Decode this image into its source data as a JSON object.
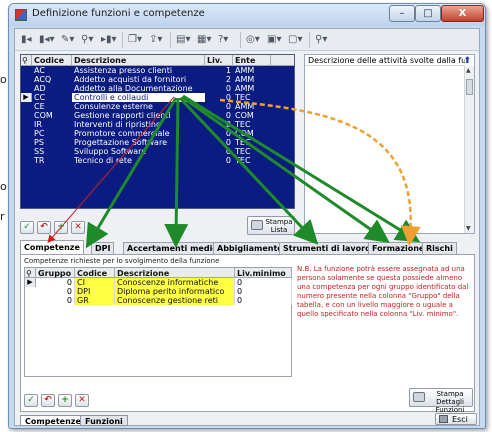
{
  "side_fragments": [
    "o",
    "o",
    "r"
  ],
  "window": {
    "title": "Definizione funzioni e competenze",
    "controls": {
      "minimize": "–",
      "maximize": "□",
      "close": "X"
    }
  },
  "toolbar": {
    "icons": [
      "record-first-icon",
      "record-prev-icon",
      "edit-icon",
      "binoculars-icon",
      "record-next-icon",
      "copy-icon",
      "export-icon",
      "print-icon",
      "filter-icon",
      "help-icon",
      "grid-icon",
      "layout-icon",
      "preview-icon"
    ]
  },
  "grid": {
    "columns": [
      "Codice",
      "Descrizione",
      "Liv.",
      "Ente"
    ],
    "selected_row": 3,
    "rows": [
      {
        "code": "AC",
        "desc": "Assistenza presso clienti",
        "liv": "1",
        "ente": "AMM"
      },
      {
        "code": "ACQ",
        "desc": "Addetto acquisti da fornitori",
        "liv": "2",
        "ente": "AMM"
      },
      {
        "code": "AD",
        "desc": "Addetto alla Documentazione",
        "liv": "0",
        "ente": "AMM"
      },
      {
        "code": "CC",
        "desc": "Controlli e collaudi",
        "liv": "0",
        "ente": "TEC"
      },
      {
        "code": "CE",
        "desc": "Consulenze esterne",
        "liv": "0",
        "ente": "AMM"
      },
      {
        "code": "COM",
        "desc": "Gestione rapporti clienti",
        "liv": "0",
        "ente": "COM"
      },
      {
        "code": "IR",
        "desc": "Interventi di ripristino",
        "liv": "0",
        "ente": "TEC"
      },
      {
        "code": "PC",
        "desc": "Promotore commerciale",
        "liv": "0",
        "ente": "COM"
      },
      {
        "code": "PS",
        "desc": "Progettazione Software",
        "liv": "0",
        "ente": "TEC"
      },
      {
        "code": "SS",
        "desc": "Sviluppo Software",
        "liv": "0",
        "ente": "TEC"
      },
      {
        "code": "TR",
        "desc": "Tecnico di rete",
        "liv": "0",
        "ente": "TEC"
      }
    ]
  },
  "desc_panel": {
    "header": "Descrizione delle attività svolte dalla funzione"
  },
  "stampa_lista": {
    "line1": "Stampa",
    "line2": "Lista"
  },
  "tabs": [
    "Competenze",
    "DPI",
    "Accertamenti medici",
    "Abbigliamento",
    "Strumenti di lavoro",
    "Formazione",
    "Rischi"
  ],
  "competenze": {
    "label": "Competenze richieste per lo svolgimento della funzione",
    "columns": [
      "Gruppo",
      "Codice",
      "Descrizione",
      "Liv.minimo"
    ],
    "rows": [
      {
        "gruppo": "0",
        "codice": "CI",
        "descrizione": "Conoscenze informatiche",
        "liv": "0"
      },
      {
        "gruppo": "0",
        "codice": "DPI",
        "descrizione": "Diploma perito informatico",
        "liv": "0"
      },
      {
        "gruppo": "0",
        "codice": "GR",
        "descrizione": "Conoscenze gestione reti",
        "liv": "0"
      }
    ],
    "note": "N.B. La funzione potrà essere assegnata ad una persona solamente se questa possiede almeno una competenza per ogni gruppo identificato dal numero presente nella colonna \"Gruppo\" della tabella, e con un livello maggiore o uguale a quello specificato nella colonna \"Liv. minimo\"."
  },
  "stampa_dettagli": {
    "line1": "Stampa Dettagli",
    "line2": "Funzioni"
  },
  "bottom_tabs": [
    "Competenze",
    "Funzioni"
  ],
  "esci": "Esci",
  "colors": {
    "grid_bg": "#0a1b82",
    "highlight": "#ffff44",
    "arrow_green": "#1f8a2a",
    "arrow_orange": "#f0a030",
    "arrow_red": "#cc2020",
    "note_red": "#c82121"
  }
}
